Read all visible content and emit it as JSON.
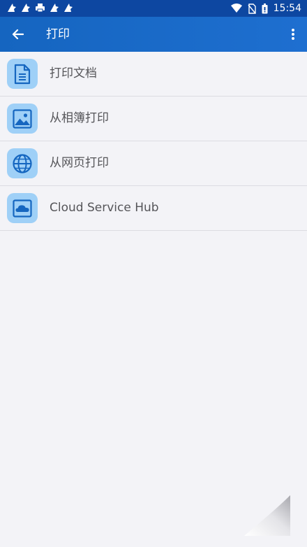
{
  "status_bar": {
    "time": "15:54",
    "left_icons": [
      "notification-icon",
      "notification-icon",
      "printer-icon",
      "notification-icon",
      "notification-icon"
    ],
    "right_icons": [
      "wifi-icon",
      "no-sim-icon",
      "battery-icon"
    ]
  },
  "app_bar": {
    "back_icon": "arrow-left-icon",
    "title": "打印",
    "menu_icon": "more-vertical-icon"
  },
  "menu": {
    "items": [
      {
        "label": "打印文档",
        "icon": "document-icon"
      },
      {
        "label": "从相簿打印",
        "icon": "image-icon"
      },
      {
        "label": "从网页打印",
        "icon": "globe-icon"
      },
      {
        "label": "Cloud Service Hub",
        "icon": "cloud-icon"
      }
    ]
  },
  "colors": {
    "status_bar": "#0d47a1",
    "app_bar": "#1565c0",
    "icon_tile": "#9fd0f7",
    "icon_stroke": "#1566c0",
    "background": "#f3f3f7"
  }
}
